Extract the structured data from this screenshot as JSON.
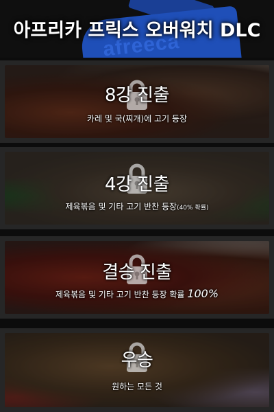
{
  "header": {
    "title": "아프리카 프릭스 오버워치 DLC",
    "bg_logo_text": "afreeca"
  },
  "panels": [
    {
      "title": "8강 진출",
      "desc": "카레 및 국(찌개)에 고기 등장"
    },
    {
      "title": "4강 진출",
      "desc_main": "제육볶음 및 기타 고기 반찬 등장",
      "desc_note": "(40% 확률)"
    },
    {
      "title": "결승 진출",
      "desc_main": "제육볶음 및 기타 고기 반찬 등장 확률 ",
      "desc_pct": "100%"
    },
    {
      "title": "우승",
      "desc": "원하는 모든 것"
    }
  ],
  "icons": {
    "lock": "lock-icon"
  },
  "colors": {
    "header_bg": "#0f0f0f",
    "logo_blue": "#1f4fb8",
    "panel_frame": "#262626",
    "text": "#ffffff"
  }
}
